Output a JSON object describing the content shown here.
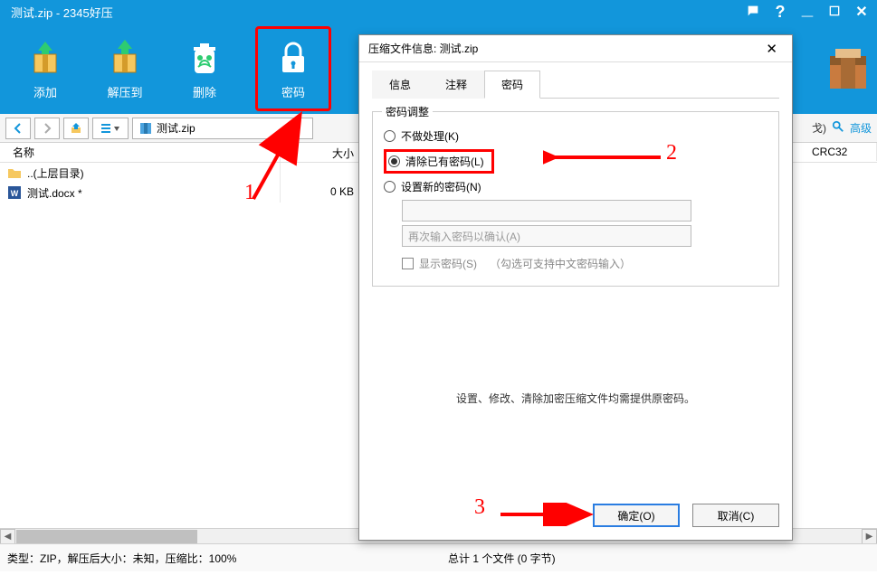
{
  "app": {
    "title": "测试.zip - 2345好压"
  },
  "titlebar_icons": {
    "chat": "chat",
    "help": "help",
    "min": "min",
    "max": "max",
    "close": "close"
  },
  "toolbar": [
    {
      "id": "add",
      "label": "添加"
    },
    {
      "id": "extract",
      "label": "解压到"
    },
    {
      "id": "delete",
      "label": "删除"
    },
    {
      "id": "password",
      "label": "密码"
    }
  ],
  "addressbar": {
    "path": "测试.zip"
  },
  "addrbar_right": {
    "text": "戈)",
    "link": "高级"
  },
  "columns": {
    "name": "名称",
    "size": "大小",
    "crc": "CRC32"
  },
  "rows": [
    {
      "type": "up",
      "name": "..(上层目录)",
      "size": ""
    },
    {
      "type": "docx",
      "name": "测试.docx *",
      "size": "0 KB"
    }
  ],
  "statusbar": {
    "left": "类型：ZIP，解压后大小：未知，压缩比：100%",
    "mid": "总计 1 个文件 (0 字节)"
  },
  "dialog": {
    "title": "压缩文件信息: 测试.zip",
    "tabs": [
      {
        "id": "info",
        "label": "信息"
      },
      {
        "id": "comment",
        "label": "注释"
      },
      {
        "id": "pass",
        "label": "密码",
        "active": true
      }
    ],
    "group_legend": "密码调整",
    "radios": [
      {
        "id": "none",
        "label": "不做处理(K)",
        "checked": false
      },
      {
        "id": "clear",
        "label": "清除已有密码(L)",
        "checked": true
      },
      {
        "id": "set",
        "label": "设置新的密码(N)",
        "checked": false
      }
    ],
    "pw_placeholder": "",
    "pw_confirm_placeholder": "再次输入密码以确认(A)",
    "show_pw_label": "显示密码(S)",
    "show_pw_hint": "（勾选可支持中文密码输入）",
    "hint": "设置、修改、清除加密压缩文件均需提供原密码。",
    "ok": "确定(O)",
    "cancel": "取消(C)"
  },
  "annotations": {
    "n1": "1",
    "n2": "2",
    "n3": "3"
  }
}
